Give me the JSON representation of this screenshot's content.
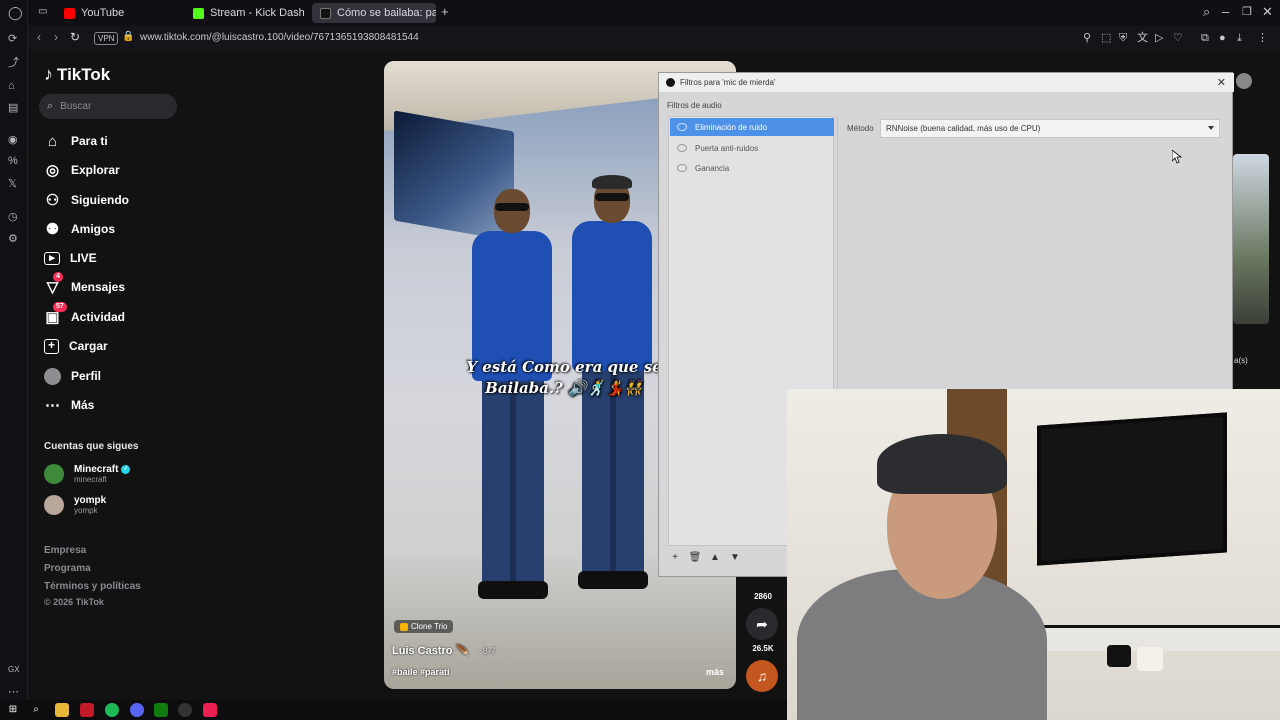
{
  "browser": {
    "tabs": [
      {
        "label": "YouTube",
        "favicon_color": "#ff0000"
      },
      {
        "label": "Stream - Kick Dashboard",
        "favicon_color": "#53fc18"
      },
      {
        "label": "Cómo se bailaba: pasos cl...",
        "favicon_color": "#111111"
      }
    ],
    "new_tab_label": "+",
    "vpn_label": "VPN",
    "url": "www.tiktok.com/@luiscastro.100/video/7671365193808481544"
  },
  "tiktok": {
    "logo_text": "TikTok",
    "search_placeholder": "Buscar",
    "nav": [
      {
        "label": "Para ti",
        "icon": "home-icon",
        "badge": ""
      },
      {
        "label": "Explorar",
        "icon": "compass-icon",
        "badge": ""
      },
      {
        "label": "Siguiendo",
        "icon": "person-plus-icon",
        "badge": ""
      },
      {
        "label": "Amigos",
        "icon": "friends-icon",
        "badge": ""
      },
      {
        "label": "LIVE",
        "icon": "live-icon",
        "badge": ""
      },
      {
        "label": "Mensajes",
        "icon": "inbox-icon",
        "badge": "4"
      },
      {
        "label": "Actividad",
        "icon": "activity-icon",
        "badge": "57"
      },
      {
        "label": "Cargar",
        "icon": "upload-icon",
        "badge": ""
      },
      {
        "label": "Perfil",
        "icon": "profile-avatar",
        "badge": ""
      },
      {
        "label": "Más",
        "icon": "more-icon",
        "badge": ""
      }
    ],
    "following_title": "Cuentas que sigues",
    "following": [
      {
        "name": "Minecraft",
        "handle": "minecraft",
        "verified": true,
        "avatar_color": "#3f8a3a"
      },
      {
        "name": "yompk",
        "handle": "yompk",
        "verified": false,
        "avatar_color": "#b8a79a"
      }
    ],
    "footer": [
      "Empresa",
      "Programa",
      "Términos y políticas",
      "© 2026 TikTok"
    ]
  },
  "video": {
    "caption_line1": "Y está Como era que se",
    "caption_line2": "Bailaba.? 🔊🕺💃👯",
    "tag": "Clone Trio",
    "author": "Luis Castro 🪶",
    "date": "· 8-7",
    "hashtags": "#baile #parati",
    "more_label": "más",
    "share_count_1": "2860",
    "share_count_2": "26.5K"
  },
  "obs_dialog": {
    "title": "Filtros para 'mic de mierda'",
    "section_label": "Filtros de audio",
    "filters": [
      {
        "label": "Eliminación de ruido",
        "selected": true
      },
      {
        "label": "Puerta anti-ruidos",
        "selected": false
      },
      {
        "label": "Ganancia",
        "selected": false
      }
    ],
    "method_label": "Método",
    "method_value": "RNNoise (buena calidad, más uso de CPU)",
    "toolbar": [
      "+",
      "🗑",
      "▲",
      "▼"
    ]
  },
  "right_pane": {
    "text": "a(s)"
  },
  "taskbar": {
    "items": [
      "start-icon",
      "search-icon",
      "file-explorer-icon",
      "opera-gx-icon",
      "spotify-icon",
      "discord-icon",
      "xbox-icon",
      "obs-icon",
      "tiktok-icon"
    ]
  },
  "colors": {
    "tiktok_pink": "#fe2c55",
    "obs_selected": "#4e91e8",
    "browser_bg": "#0f0f14"
  }
}
